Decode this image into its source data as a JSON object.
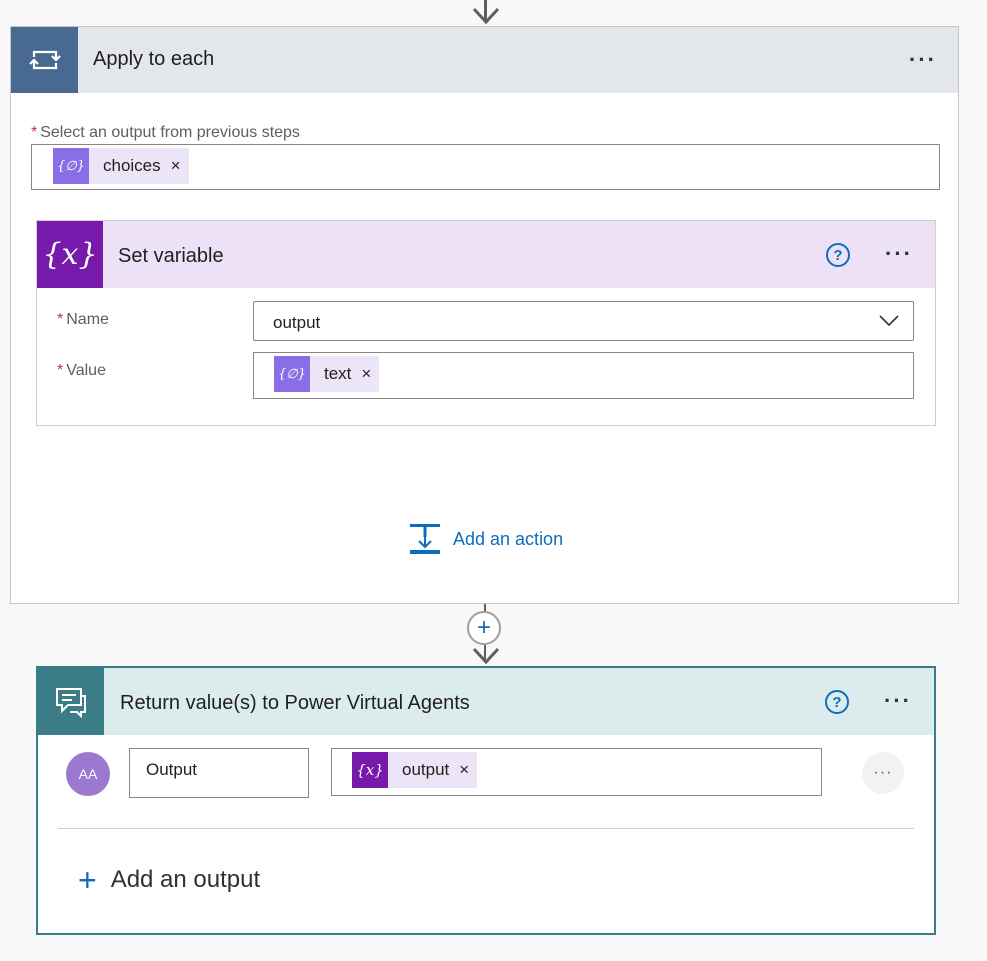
{
  "apply_each": {
    "title": "Apply to each",
    "more_label": "···",
    "field_label": "Select an output from previous steps",
    "required_mark": "*",
    "token": {
      "text": "choices",
      "icon": "{∅}",
      "remove": "×"
    }
  },
  "set_variable": {
    "title": "Set variable",
    "icon": "{x}",
    "help_label": "?",
    "more_label": "···",
    "name_label": "Name",
    "name_value": "output",
    "value_label": "Value",
    "required_mark": "*",
    "value_token": {
      "text": "text",
      "icon": "{∅}",
      "remove": "×"
    }
  },
  "add_action": {
    "label": "Add an action"
  },
  "connector": {
    "plus": "+"
  },
  "return_pva": {
    "title": "Return value(s) to Power Virtual Agents",
    "help_label": "?",
    "more_label": "···",
    "avatar_text": "AA",
    "output_name": "Output",
    "output_token": {
      "text": "output",
      "icon": "{x}",
      "remove": "×"
    },
    "row_more": "···",
    "add_output_plus": "+",
    "add_output_label": "Add an output"
  },
  "colors": {
    "apply_icon_bg": "#486991",
    "setvar_icon_bg": "#7719aa",
    "return_accent": "#3a7d86",
    "link_blue": "#0f6cbd"
  }
}
